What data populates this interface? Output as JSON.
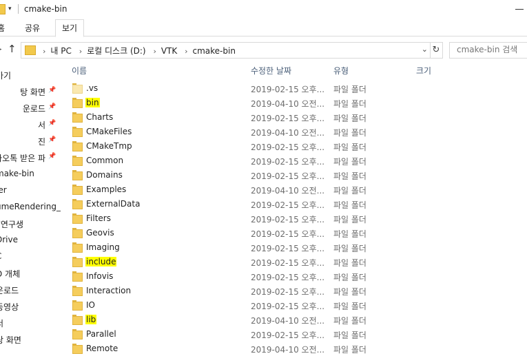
{
  "window": {
    "title": "cmake-bin"
  },
  "ribbon": {
    "tabs": [
      "홈",
      "공유",
      "보기"
    ]
  },
  "address": {
    "crumbs": [
      "내 PC",
      "로컬 디스크 (D:)",
      "VTK",
      "cmake-bin"
    ],
    "search_placeholder": "cmake-bin 검색"
  },
  "sidebar": {
    "items": [
      {
        "label": "가기",
        "pinned": false
      },
      {
        "label": "탕 화면",
        "pinned": true
      },
      {
        "label": "운로드",
        "pinned": true
      },
      {
        "label": "서",
        "pinned": true
      },
      {
        "label": "진",
        "pinned": true
      },
      {
        "label": "카오톡 받은 파",
        "pinned": true
      },
      {
        "label": "make-bin",
        "pinned": false
      },
      {
        "label": "ler",
        "pinned": false
      },
      {
        "label": "umeRendering_V",
        "pinned": false
      },
      {
        "label": "F연구생",
        "pinned": false
      },
      {
        "label": "Drive",
        "pinned": false
      },
      {
        "label": "C",
        "pinned": false
      },
      {
        "label": "D 개체",
        "pinned": false
      },
      {
        "label": "운로드",
        "pinned": false
      },
      {
        "label": "동영상",
        "pinned": false
      },
      {
        "label": "서",
        "pinned": false
      },
      {
        "label": "탕 화면",
        "pinned": false
      }
    ]
  },
  "columns": {
    "name": "이름",
    "date": "수정한 날짜",
    "type": "유형",
    "size": "크기"
  },
  "files": [
    {
      "name": ".vs",
      "date": "2019-02-15 오후...",
      "type": "파일 폴더",
      "highlight": false
    },
    {
      "name": "bin",
      "date": "2019-04-10 오전...",
      "type": "파일 폴더",
      "highlight": true
    },
    {
      "name": "Charts",
      "date": "2019-02-15 오후...",
      "type": "파일 폴더",
      "highlight": false
    },
    {
      "name": "CMakeFiles",
      "date": "2019-04-10 오전...",
      "type": "파일 폴더",
      "highlight": false
    },
    {
      "name": "CMakeTmp",
      "date": "2019-02-15 오후...",
      "type": "파일 폴더",
      "highlight": false
    },
    {
      "name": "Common",
      "date": "2019-02-15 오후...",
      "type": "파일 폴더",
      "highlight": false
    },
    {
      "name": "Domains",
      "date": "2019-02-15 오후...",
      "type": "파일 폴더",
      "highlight": false
    },
    {
      "name": "Examples",
      "date": "2019-04-10 오전...",
      "type": "파일 폴더",
      "highlight": false
    },
    {
      "name": "ExternalData",
      "date": "2019-02-15 오후...",
      "type": "파일 폴더",
      "highlight": false
    },
    {
      "name": "Filters",
      "date": "2019-02-15 오후...",
      "type": "파일 폴더",
      "highlight": false
    },
    {
      "name": "Geovis",
      "date": "2019-02-15 오후...",
      "type": "파일 폴더",
      "highlight": false
    },
    {
      "name": "Imaging",
      "date": "2019-02-15 오후...",
      "type": "파일 폴더",
      "highlight": false
    },
    {
      "name": "include",
      "date": "2019-02-15 오후...",
      "type": "파일 폴더",
      "highlight": true
    },
    {
      "name": "Infovis",
      "date": "2019-02-15 오후...",
      "type": "파일 폴더",
      "highlight": false
    },
    {
      "name": "Interaction",
      "date": "2019-02-15 오후...",
      "type": "파일 폴더",
      "highlight": false
    },
    {
      "name": "IO",
      "date": "2019-02-15 오후...",
      "type": "파일 폴더",
      "highlight": false
    },
    {
      "name": "lib",
      "date": "2019-04-10 오전...",
      "type": "파일 폴더",
      "highlight": true
    },
    {
      "name": "Parallel",
      "date": "2019-02-15 오후...",
      "type": "파일 폴더",
      "highlight": false
    },
    {
      "name": "Remote",
      "date": "2019-04-10 오전...",
      "type": "파일 폴더",
      "highlight": false
    }
  ],
  "colors": {
    "highlight": "#ffff00",
    "folder": "#f5cd5c",
    "header_text": "#4c607a"
  }
}
